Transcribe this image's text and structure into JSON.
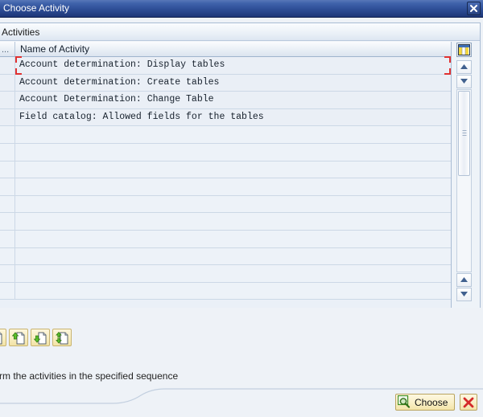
{
  "window": {
    "title": "Choose Activity",
    "close_icon": "close-icon"
  },
  "panel": {
    "title": "Activities"
  },
  "table": {
    "columns": [
      {
        "key": "sel",
        "label": "..."
      },
      {
        "key": "name",
        "label": "Name of Activity"
      }
    ],
    "rows": [
      {
        "name": "Account determination: Display tables",
        "selected": true
      },
      {
        "name": "Account determination: Create tables",
        "selected": false
      },
      {
        "name": "Account Determination: Change Table",
        "selected": false
      },
      {
        "name": "Field catalog: Allowed fields for the tables",
        "selected": false
      }
    ],
    "empty_row_count": 10,
    "config_icon": "table-settings-icon",
    "scroll_up_icon": "scroll-up-icon",
    "scroll_down_icon": "scroll-down-icon"
  },
  "toolbar": {
    "buttons": [
      {
        "name": "document-clipped-button",
        "icon": "document-icon"
      },
      {
        "name": "document-up-button",
        "icon": "document-arrow-up-icon"
      },
      {
        "name": "document-down-button",
        "icon": "document-arrow-down-icon"
      },
      {
        "name": "document-updown-button",
        "icon": "document-arrow-updown-icon"
      }
    ]
  },
  "hint": {
    "text": "rform the activities in the specified sequence"
  },
  "footer": {
    "choose_label": "Choose",
    "choose_icon": "magnifier-icon",
    "cancel_icon": "cancel-x-icon"
  },
  "colors": {
    "title_bar_start": "#5878b8",
    "title_bar_end": "#1d3678",
    "selection_marker": "#e03131",
    "button_yellow": "#f9efc6",
    "icon_green": "#4caf2f",
    "cancel_red": "#d42a2a"
  }
}
